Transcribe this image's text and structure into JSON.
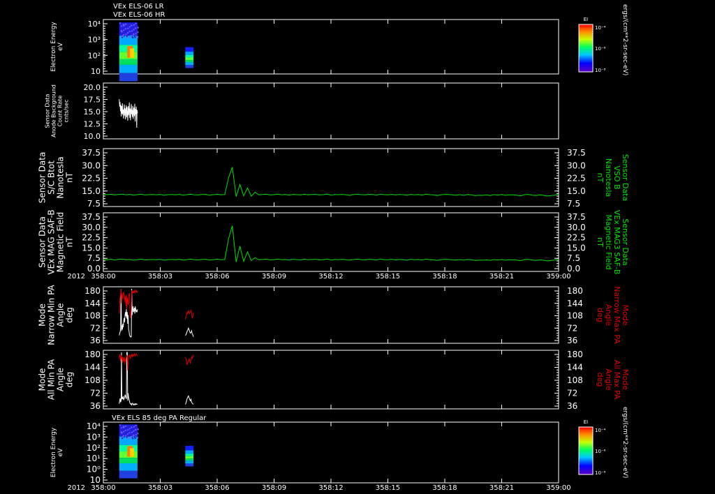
{
  "header": {
    "line1": "VEx ELS-06 LR",
    "line2": "VEx ELS-06 HR"
  },
  "footer_year": "2012",
  "colorbar_unit": "ergs/(cm**2-sr-sec-eV)",
  "colorbar_label": "EI",
  "colorbar_ticks": [
    "10⁻⁴",
    "10⁻⁶",
    "10⁻⁸"
  ],
  "time_ticks": [
    "358:00",
    "358:03",
    "358:06",
    "358:09",
    "358:12",
    "358:15",
    "358:18",
    "358:21",
    "359:00"
  ],
  "panels": [
    {
      "id": "els-energy-1",
      "type": "heatmap",
      "left_label": [
        "Electron Energy",
        "eV"
      ],
      "left_color": "#ffffff",
      "yticks": [
        "10⁴",
        "10³",
        "10²",
        "10"
      ],
      "blocks": [
        {
          "t_start": 358.035,
          "t_end": 358.075,
          "e_low": 1,
          "e_high": 10000
        },
        {
          "t_start": 358.18,
          "t_end": 358.198,
          "e_low": 8,
          "e_high": 250
        }
      ]
    },
    {
      "id": "anode-background",
      "type": "line",
      "left_label": [
        "Sensor Data",
        "Anode Background",
        "Count Rate",
        "cnts/sec"
      ],
      "left_color": "#ffffff",
      "yticks": [
        "20.0",
        "17.5",
        "15.0",
        "12.5",
        "10.0"
      ],
      "ylim": [
        7.5,
        20.0
      ],
      "series": [
        {
          "color": "#ffffff",
          "t_start": 358.035,
          "t_end": 358.075,
          "values": [
            16.6,
            14.8,
            15.9,
            13.7,
            15.2,
            12.4,
            14.9,
            13.1,
            15.6,
            12.8,
            14.1,
            11.9,
            13.8,
            15.3,
            12.6,
            14.4,
            11.7,
            13.9,
            15.1,
            12.2,
            14.7,
            13.3,
            11.4,
            14.9,
            12.7,
            13.6,
            15.8,
            12.1,
            14.3,
            11.5,
            13.8,
            15.4,
            12.9,
            14.0,
            12.3,
            15.0,
            11.8,
            13.5,
            14.6,
            12.5,
            15.5,
            11.2,
            14.2,
            13.0,
            14.8,
            9.7,
            14.0,
            13.2
          ]
        }
      ]
    },
    {
      "id": "sc-btot",
      "type": "line",
      "left_label": [
        "Sensor Data",
        "S/C Btot",
        "Nanotesla",
        "nT"
      ],
      "left_color": "#ffffff",
      "right_label": [
        "Sensor Data",
        "VSO B",
        "Nanotesla",
        "nT"
      ],
      "right_color": "#00e000",
      "yticks": [
        "37.5",
        "30.0",
        "22.5",
        "15.0",
        "7.5"
      ],
      "ylim": [
        0,
        37.5
      ],
      "series": [
        {
          "color": "#00e000",
          "t_start": 358.0,
          "t_end": 359.0,
          "values": [
            7.0,
            6.8,
            7.1,
            6.6,
            6.9,
            7.2,
            6.7,
            7.0,
            6.5,
            6.8,
            7.1,
            6.6,
            6.8,
            6.9,
            6.7,
            7.0,
            6.4,
            6.8,
            6.9,
            6.7,
            7.0,
            6.5,
            6.8,
            7.1,
            6.7,
            6.6,
            6.9,
            7.0,
            6.5,
            6.8,
            7.1,
            6.7,
            6.9,
            18.5,
            26.0,
            5.5,
            14.0,
            6.0,
            11.5,
            5.8,
            8.5,
            6.7,
            6.9,
            7.1,
            6.6,
            6.8,
            7.2,
            6.7,
            6.9,
            6.5,
            7.0,
            6.8,
            6.6,
            7.1,
            6.7,
            6.9,
            7.0,
            6.6,
            6.8,
            7.2,
            6.5,
            6.9,
            6.8,
            7.0,
            6.7,
            6.4,
            6.9,
            7.1,
            6.8,
            6.6,
            7.0,
            6.9,
            6.5,
            7.2,
            6.8,
            6.7,
            7.0,
            6.6,
            6.9,
            6.8,
            6.4,
            7.0,
            6.7,
            6.9,
            6.5,
            7.1,
            6.8,
            6.6,
            6.3,
            6.7,
            7.0,
            6.9,
            6.6,
            6.5,
            6.8,
            6.4,
            6.9,
            6.7,
            6.2,
            6.5,
            6.4,
            6.6,
            6.3,
            6.8,
            6.5,
            6.9,
            6.4,
            6.7,
            6.6,
            6.5,
            6.1,
            6.8,
            7.0,
            6.5,
            6.3,
            6.6,
            6.4,
            5.9,
            6.2,
            6.5,
            7.2
          ]
        }
      ]
    },
    {
      "id": "mag-saf-b",
      "type": "line",
      "left_label": [
        "Sensor Data",
        "VEx MAG SAF-B",
        "Magnetic Field",
        "nT"
      ],
      "left_color": "#ffffff",
      "right_label": [
        "Sensor Data",
        "VEx MAG3 SAF-B",
        "Magnetic Field",
        "nT"
      ],
      "right_color": "#00e000",
      "yticks": [
        "37.5",
        "30.0",
        "22.5",
        "15.0",
        "7.5",
        "0.0"
      ],
      "ylim": [
        0,
        37.5
      ],
      "series": [
        {
          "color": "#00e000",
          "t_start": 358.0,
          "t_end": 359.0,
          "values": [
            6.8,
            6.5,
            7.0,
            6.4,
            6.9,
            7.1,
            6.6,
            6.8,
            6.3,
            6.7,
            7.0,
            6.5,
            6.7,
            6.8,
            6.6,
            6.9,
            6.3,
            6.7,
            6.8,
            6.6,
            6.9,
            6.4,
            6.7,
            7.0,
            6.6,
            6.5,
            6.8,
            6.9,
            6.4,
            6.7,
            7.0,
            6.6,
            6.8,
            21.0,
            30.0,
            5.0,
            16.0,
            5.5,
            12.0,
            6.0,
            8.0,
            6.6,
            6.8,
            7.0,
            6.5,
            6.7,
            7.1,
            6.6,
            6.8,
            6.4,
            6.9,
            6.7,
            6.5,
            7.0,
            6.6,
            6.8,
            6.9,
            6.5,
            6.7,
            7.1,
            6.4,
            6.8,
            6.7,
            6.9,
            6.6,
            6.3,
            6.8,
            7.0,
            6.7,
            6.5,
            6.9,
            6.8,
            6.4,
            7.1,
            6.7,
            6.6,
            6.9,
            6.5,
            6.8,
            6.7,
            6.3,
            6.9,
            6.6,
            6.8,
            6.4,
            7.0,
            6.7,
            6.5,
            6.2,
            6.6,
            6.9,
            6.8,
            6.5,
            6.4,
            6.7,
            6.3,
            6.8,
            6.6,
            6.1,
            6.4,
            6.3,
            6.5,
            6.2,
            6.7,
            6.4,
            6.8,
            6.3,
            6.6,
            6.5,
            6.4,
            6.0,
            6.7,
            6.9,
            6.4,
            6.2,
            6.5,
            6.3,
            5.8,
            6.1,
            6.4,
            7.0
          ]
        }
      ]
    },
    {
      "id": "narrow-pa",
      "type": "line",
      "left_label": [
        "Mode",
        "Narrow Min PA",
        "Angle",
        "deg"
      ],
      "left_color": "#ffffff",
      "right_label": [
        "Mode",
        "Narrow Max PA",
        "Angle",
        "deg"
      ],
      "right_color": "#dd0000",
      "yticks": [
        "180",
        "144",
        "108",
        "72",
        "36"
      ],
      "ylim": [
        0,
        180
      ],
      "series": [
        {
          "color": "#ffffff",
          "t_start": 358.035,
          "t_end": 358.075,
          "values": [
            20,
            28,
            32,
            45,
            180,
            35,
            55,
            40,
            60,
            48,
            70,
            80,
            65,
            90,
            100,
            85,
            110,
            78,
            100,
            60,
            90,
            40,
            35,
            20,
            18,
            15,
            16,
            15,
            180,
            90,
            110,
            120,
            100,
            105,
            115,
            95,
            120,
            110,
            100,
            105,
            100,
            110
          ]
        },
        {
          "color": "#ffffff",
          "t_start": 358.18,
          "t_end": 358.198,
          "values": [
            20,
            22,
            28,
            35,
            38,
            45,
            40,
            32,
            28,
            30,
            36,
            25,
            22,
            15
          ]
        },
        {
          "color": "#dd0000",
          "t_start": 358.035,
          "t_end": 358.075,
          "values": [
            95,
            140,
            150,
            160,
            180,
            130,
            165,
            150,
            145,
            160,
            170,
            160,
            150,
            135,
            155,
            120,
            160,
            110,
            150,
            140,
            125,
            155,
            160,
            165,
            100,
            80,
            90,
            110,
            175,
            165,
            170,
            168,
            172,
            165,
            170,
            175,
            168,
            172,
            175,
            170,
            168,
            172
          ]
        },
        {
          "color": "#dd0000",
          "t_start": 358.18,
          "t_end": 358.198,
          "values": [
            75,
            85,
            90,
            100,
            95,
            105,
            98,
            95,
            100,
            108,
            95,
            80,
            85,
            98
          ]
        }
      ]
    },
    {
      "id": "all-pa",
      "type": "line",
      "left_label": [
        "Mode",
        "All Min PA",
        "Angle",
        "deg"
      ],
      "left_color": "#ffffff",
      "right_label": [
        "Mode",
        "All Max PA",
        "Angle",
        "deg"
      ],
      "right_color": "#dd0000",
      "yticks": [
        "180",
        "144",
        "108",
        "72",
        "36"
      ],
      "ylim": [
        0,
        180
      ],
      "series": [
        {
          "color": "#ffffff",
          "t_start": 358.035,
          "t_end": 358.075,
          "values": [
            10,
            22,
            28,
            15,
            20,
            180,
            25,
            30,
            26,
            35,
            22,
            28,
            30,
            40,
            36,
            30,
            26,
            180,
            180,
            20,
            45,
            30,
            25,
            18,
            12,
            10,
            8,
            10,
            6,
            12,
            10,
            8,
            6,
            10,
            8,
            6,
            10,
            8,
            10,
            8,
            9,
            8
          ]
        },
        {
          "color": "#ffffff",
          "t_start": 358.18,
          "t_end": 358.198,
          "values": [
            8,
            12,
            20,
            28,
            32,
            36,
            30,
            24,
            20,
            25,
            15,
            12,
            10,
            8
          ]
        },
        {
          "color": "#dd0000",
          "t_start": 358.035,
          "t_end": 358.075,
          "values": [
            160,
            175,
            168,
            150,
            165,
            170,
            155,
            165,
            145,
            160,
            150,
            165,
            158,
            140,
            160,
            150,
            162,
            170,
            168,
            120,
            150,
            165,
            168,
            170,
            165,
            160,
            170,
            168,
            172,
            165,
            175,
            170,
            168,
            172,
            175,
            170,
            168,
            172,
            175,
            172,
            170,
            172
          ]
        },
        {
          "color": "#dd0000",
          "t_start": 358.18,
          "t_end": 358.198,
          "values": [
            165,
            158,
            148,
            140,
            145,
            152,
            160,
            150,
            145,
            155,
            165,
            160,
            168,
            172
          ]
        }
      ]
    },
    {
      "id": "els-85deg",
      "type": "heatmap",
      "title": "VEx ELS 85 deg PA Regular",
      "left_label": [
        "Electron Energy",
        "eV"
      ],
      "left_color": "#ffffff",
      "yticks": [
        "10⁴",
        "10³",
        "10²",
        "10¹",
        "10⁰",
        "10"
      ],
      "blocks": [
        {
          "t_start": 358.035,
          "t_end": 358.075,
          "e_low": 0.3,
          "e_high": 10000
        },
        {
          "t_start": 358.18,
          "t_end": 358.198,
          "e_low": 3,
          "e_high": 200
        }
      ]
    }
  ]
}
